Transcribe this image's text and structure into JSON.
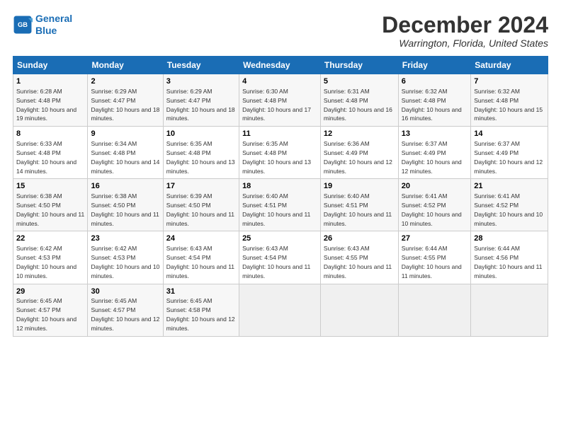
{
  "logo": {
    "line1": "General",
    "line2": "Blue"
  },
  "title": "December 2024",
  "location": "Warrington, Florida, United States",
  "days_of_week": [
    "Sunday",
    "Monday",
    "Tuesday",
    "Wednesday",
    "Thursday",
    "Friday",
    "Saturday"
  ],
  "weeks": [
    [
      {
        "day": "1",
        "sunrise": "6:28 AM",
        "sunset": "4:48 PM",
        "daylight": "10 hours and 19 minutes."
      },
      {
        "day": "2",
        "sunrise": "6:29 AM",
        "sunset": "4:47 PM",
        "daylight": "10 hours and 18 minutes."
      },
      {
        "day": "3",
        "sunrise": "6:29 AM",
        "sunset": "4:47 PM",
        "daylight": "10 hours and 18 minutes."
      },
      {
        "day": "4",
        "sunrise": "6:30 AM",
        "sunset": "4:48 PM",
        "daylight": "10 hours and 17 minutes."
      },
      {
        "day": "5",
        "sunrise": "6:31 AM",
        "sunset": "4:48 PM",
        "daylight": "10 hours and 16 minutes."
      },
      {
        "day": "6",
        "sunrise": "6:32 AM",
        "sunset": "4:48 PM",
        "daylight": "10 hours and 16 minutes."
      },
      {
        "day": "7",
        "sunrise": "6:32 AM",
        "sunset": "4:48 PM",
        "daylight": "10 hours and 15 minutes."
      }
    ],
    [
      {
        "day": "8",
        "sunrise": "6:33 AM",
        "sunset": "4:48 PM",
        "daylight": "10 hours and 14 minutes."
      },
      {
        "day": "9",
        "sunrise": "6:34 AM",
        "sunset": "4:48 PM",
        "daylight": "10 hours and 14 minutes."
      },
      {
        "day": "10",
        "sunrise": "6:35 AM",
        "sunset": "4:48 PM",
        "daylight": "10 hours and 13 minutes."
      },
      {
        "day": "11",
        "sunrise": "6:35 AM",
        "sunset": "4:48 PM",
        "daylight": "10 hours and 13 minutes."
      },
      {
        "day": "12",
        "sunrise": "6:36 AM",
        "sunset": "4:49 PM",
        "daylight": "10 hours and 12 minutes."
      },
      {
        "day": "13",
        "sunrise": "6:37 AM",
        "sunset": "4:49 PM",
        "daylight": "10 hours and 12 minutes."
      },
      {
        "day": "14",
        "sunrise": "6:37 AM",
        "sunset": "4:49 PM",
        "daylight": "10 hours and 12 minutes."
      }
    ],
    [
      {
        "day": "15",
        "sunrise": "6:38 AM",
        "sunset": "4:50 PM",
        "daylight": "10 hours and 11 minutes."
      },
      {
        "day": "16",
        "sunrise": "6:38 AM",
        "sunset": "4:50 PM",
        "daylight": "10 hours and 11 minutes."
      },
      {
        "day": "17",
        "sunrise": "6:39 AM",
        "sunset": "4:50 PM",
        "daylight": "10 hours and 11 minutes."
      },
      {
        "day": "18",
        "sunrise": "6:40 AM",
        "sunset": "4:51 PM",
        "daylight": "10 hours and 11 minutes."
      },
      {
        "day": "19",
        "sunrise": "6:40 AM",
        "sunset": "4:51 PM",
        "daylight": "10 hours and 11 minutes."
      },
      {
        "day": "20",
        "sunrise": "6:41 AM",
        "sunset": "4:52 PM",
        "daylight": "10 hours and 10 minutes."
      },
      {
        "day": "21",
        "sunrise": "6:41 AM",
        "sunset": "4:52 PM",
        "daylight": "10 hours and 10 minutes."
      }
    ],
    [
      {
        "day": "22",
        "sunrise": "6:42 AM",
        "sunset": "4:53 PM",
        "daylight": "10 hours and 10 minutes."
      },
      {
        "day": "23",
        "sunrise": "6:42 AM",
        "sunset": "4:53 PM",
        "daylight": "10 hours and 10 minutes."
      },
      {
        "day": "24",
        "sunrise": "6:43 AM",
        "sunset": "4:54 PM",
        "daylight": "10 hours and 11 minutes."
      },
      {
        "day": "25",
        "sunrise": "6:43 AM",
        "sunset": "4:54 PM",
        "daylight": "10 hours and 11 minutes."
      },
      {
        "day": "26",
        "sunrise": "6:43 AM",
        "sunset": "4:55 PM",
        "daylight": "10 hours and 11 minutes."
      },
      {
        "day": "27",
        "sunrise": "6:44 AM",
        "sunset": "4:55 PM",
        "daylight": "10 hours and 11 minutes."
      },
      {
        "day": "28",
        "sunrise": "6:44 AM",
        "sunset": "4:56 PM",
        "daylight": "10 hours and 11 minutes."
      }
    ],
    [
      {
        "day": "29",
        "sunrise": "6:45 AM",
        "sunset": "4:57 PM",
        "daylight": "10 hours and 12 minutes."
      },
      {
        "day": "30",
        "sunrise": "6:45 AM",
        "sunset": "4:57 PM",
        "daylight": "10 hours and 12 minutes."
      },
      {
        "day": "31",
        "sunrise": "6:45 AM",
        "sunset": "4:58 PM",
        "daylight": "10 hours and 12 minutes."
      },
      null,
      null,
      null,
      null
    ]
  ]
}
